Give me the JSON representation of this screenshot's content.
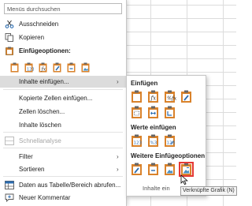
{
  "search": {
    "placeholder": "Menüs durchsuchen"
  },
  "menu": {
    "cut": "Ausschneiden",
    "copy": "Kopieren",
    "paste_options_header": "Einfügeoptionen:",
    "paste_special": "Inhalte einfügen...",
    "insert_copied_cells": "Kopierte Zellen einfügen...",
    "delete_cells": "Zellen löschen...",
    "clear_contents": "Inhalte löschen",
    "quick_analysis": "Schnellanalyse",
    "filter": "Filter",
    "sort": "Sortieren",
    "get_data": "Daten aus Tabelle/Bereich abrufen...",
    "new_comment": "Neuer Kommentar"
  },
  "submenu": {
    "paste_header": "Einfügen",
    "paste_values_header": "Werte einfügen",
    "more_options_header": "Weitere Einfügeoptionen",
    "bottom_label": "Inhalte ein"
  },
  "tooltip": {
    "text": "Verknüpfte Grafik (N)"
  },
  "colors": {
    "accent_red": "#e53935",
    "icon_blue": "#2b6cb0",
    "clipboard_orange": "#d9822b"
  }
}
